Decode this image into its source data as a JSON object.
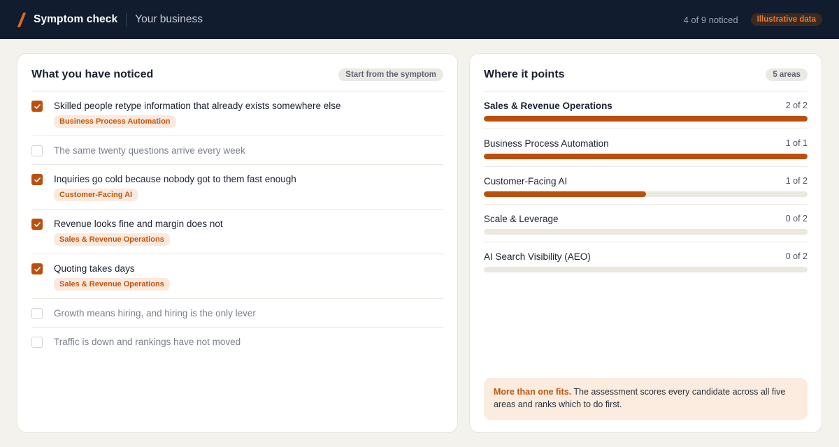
{
  "header": {
    "title": "Symptom check",
    "subtitle": "Your business",
    "noticed_count": "4 of 9 noticed",
    "badge": "Illustrative data",
    "logo_icon": "slash-logo-icon"
  },
  "colors": {
    "accent": "#bb4f0b",
    "header_bg": "#111c2e",
    "page_bg": "#f4f2ed"
  },
  "left_panel": {
    "title": "What you have noticed",
    "pill": "Start from the symptom",
    "items": [
      {
        "text": "Skilled people retype information that already exists somewhere else",
        "checked": true,
        "tag": "Business Process Automation"
      },
      {
        "text": "The same twenty questions arrive every week",
        "checked": false,
        "tag": ""
      },
      {
        "text": "Inquiries go cold because nobody got to them fast enough",
        "checked": true,
        "tag": "Customer-Facing AI"
      },
      {
        "text": "Revenue looks fine and margin does not",
        "checked": true,
        "tag": "Sales & Revenue Operations"
      },
      {
        "text": "Quoting takes days",
        "checked": true,
        "tag": "Sales & Revenue Operations"
      },
      {
        "text": "Growth means hiring, and hiring is the only lever",
        "checked": false,
        "tag": ""
      },
      {
        "text": "Traffic is down and rankings have not moved",
        "checked": false,
        "tag": ""
      }
    ]
  },
  "right_panel": {
    "title": "Where it points",
    "pill": "5 areas",
    "areas": [
      {
        "name": "Sales & Revenue Operations",
        "count": "2 of 2",
        "fraction": 1.0,
        "top": true
      },
      {
        "name": "Business Process Automation",
        "count": "1 of 1",
        "fraction": 1.0,
        "top": false
      },
      {
        "name": "Customer-Facing AI",
        "count": "1 of 2",
        "fraction": 0.5,
        "top": false
      },
      {
        "name": "Scale & Leverage",
        "count": "0 of 2",
        "fraction": 0.0,
        "top": false
      },
      {
        "name": "AI Search Visibility (AEO)",
        "count": "0 of 2",
        "fraction": 0.0,
        "top": false
      }
    ],
    "note": {
      "lead": "More than one fits.",
      "body": " The assessment scores every candidate across all five areas and ranks which to do first."
    }
  }
}
